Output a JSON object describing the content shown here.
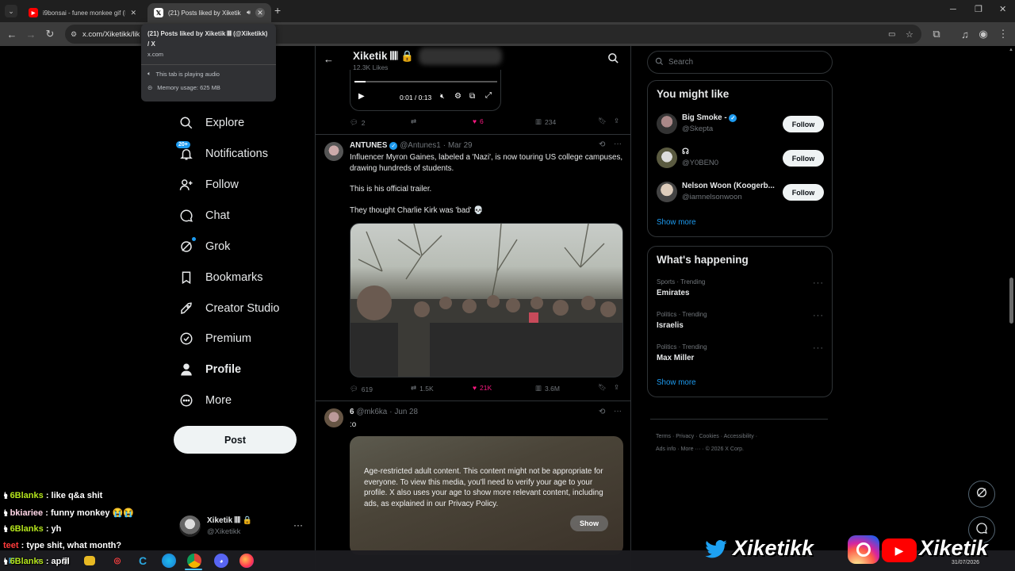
{
  "tabs": [
    {
      "title": "i9bonsai - funee monkee gif (M...",
      "favicon": "youtube-icon"
    },
    {
      "title": "(21) Posts liked by Xiketik | X",
      "favicon": "x-icon"
    }
  ],
  "address": {
    "url": "x.com/Xiketikk/lik"
  },
  "tooltip": {
    "title": "(21) Posts liked by Xiketik 𝄃𝄃𝄃 (@Xiketikk) / X",
    "domain": "x.com",
    "audio": "This tab is playing audio",
    "memory": "Memory usage: 625 MB"
  },
  "nav": {
    "items": [
      {
        "label": "Explore",
        "icon": "search-icon"
      },
      {
        "label": "Notifications",
        "icon": "bell-icon",
        "badge": "20+"
      },
      {
        "label": "Follow",
        "icon": "person-add-icon"
      },
      {
        "label": "Chat",
        "icon": "chat-icon"
      },
      {
        "label": "Grok",
        "icon": "grok-icon"
      },
      {
        "label": "Bookmarks",
        "icon": "bookmark-icon"
      },
      {
        "label": "Creator Studio",
        "icon": "rocket-icon"
      },
      {
        "label": "Premium",
        "icon": "verified-icon"
      },
      {
        "label": "Profile",
        "icon": "person-icon"
      },
      {
        "label": "More",
        "icon": "more-circle-icon"
      }
    ],
    "post_label": "Post"
  },
  "account": {
    "name": "Xiketik 𝄃𝄃𝄃 🔒",
    "handle": "@Xiketikk"
  },
  "header": {
    "name": "Xiketik 𝄃𝄃𝄃 🔒",
    "likes": "12.3K Likes"
  },
  "video": {
    "time": "0:01 / 0:13",
    "progress": 0.08
  },
  "tweet0": {
    "replies": "2",
    "reposts": "",
    "likes": "6",
    "views": "234"
  },
  "tweet1": {
    "name": "ANTUNES",
    "handle": "@Antunes1",
    "date": "Mar 29",
    "text1": "Influencer Myron Gaines, labeled a 'Nazi', is now touring US college campuses, drawing hundreds of students.",
    "text2": "This is his official trailer.",
    "text3": "They thought Charlie Kirk was 'bad' 💀",
    "replies": "619",
    "reposts": "1.5K",
    "likes": "21K",
    "views": "3.6M"
  },
  "tweet2": {
    "name": "6",
    "handle": "@mk6ka",
    "date": "Jun 28",
    "text": ":o",
    "warning": "Age-restricted adult content. This content might not be appropriate for everyone. To view this media, you'll need to verify your age to your profile. X also uses your age to show more relevant content, including ads, as explained in our Privacy Policy.",
    "show_label": "Show"
  },
  "search": {
    "placeholder": "Search"
  },
  "you_might_like": {
    "title": "You might like",
    "users": [
      {
        "name": "Big Smoke -",
        "handle": "@Skepta",
        "follow": "Follow"
      },
      {
        "name": "☊",
        "handle": "@Y0BEN0",
        "follow": "Follow"
      },
      {
        "name": "Nelson Woon (Koogerb...",
        "handle": "@iamnelsonwoon",
        "follow": "Follow"
      }
    ],
    "show_more": "Show more"
  },
  "happening": {
    "title": "What's happening",
    "trends": [
      {
        "meta": "Sports · Trending",
        "name": "Emirates"
      },
      {
        "meta": "Politics · Trending",
        "name": "Israelis"
      },
      {
        "meta": "Politics · Trending",
        "name": "Max Miller"
      }
    ],
    "show_more": "Show more"
  },
  "footer": {
    "line1": [
      "Terms",
      "Privacy",
      "Cookies",
      "Accessibility"
    ],
    "line2": [
      "Ads info",
      "More ···",
      "© 2026 X Corp."
    ]
  },
  "chat": [
    {
      "user": "6Blanks",
      "msg": "like q&a shit",
      "color": "#b5e61d"
    },
    {
      "user": "bkiariee",
      "msg": "funny monkey 😭😭",
      "color": "#ffd6e7"
    },
    {
      "user": "6Blanks",
      "msg": "yh",
      "color": "#b5e61d"
    },
    {
      "user": "teet",
      "msg": "type shit, what month?",
      "color": "#ff3b3b"
    },
    {
      "user": "6Blanks",
      "msg": "april",
      "color": "#b5e61d"
    }
  ],
  "overlay": {
    "left_name": "Xiketikk",
    "right_name": "Xiketik"
  },
  "taskbar": {
    "date": "31/07/2026"
  },
  "colors": {
    "accent": "#1d9bf0",
    "like": "#f91880",
    "background": "#000000"
  }
}
